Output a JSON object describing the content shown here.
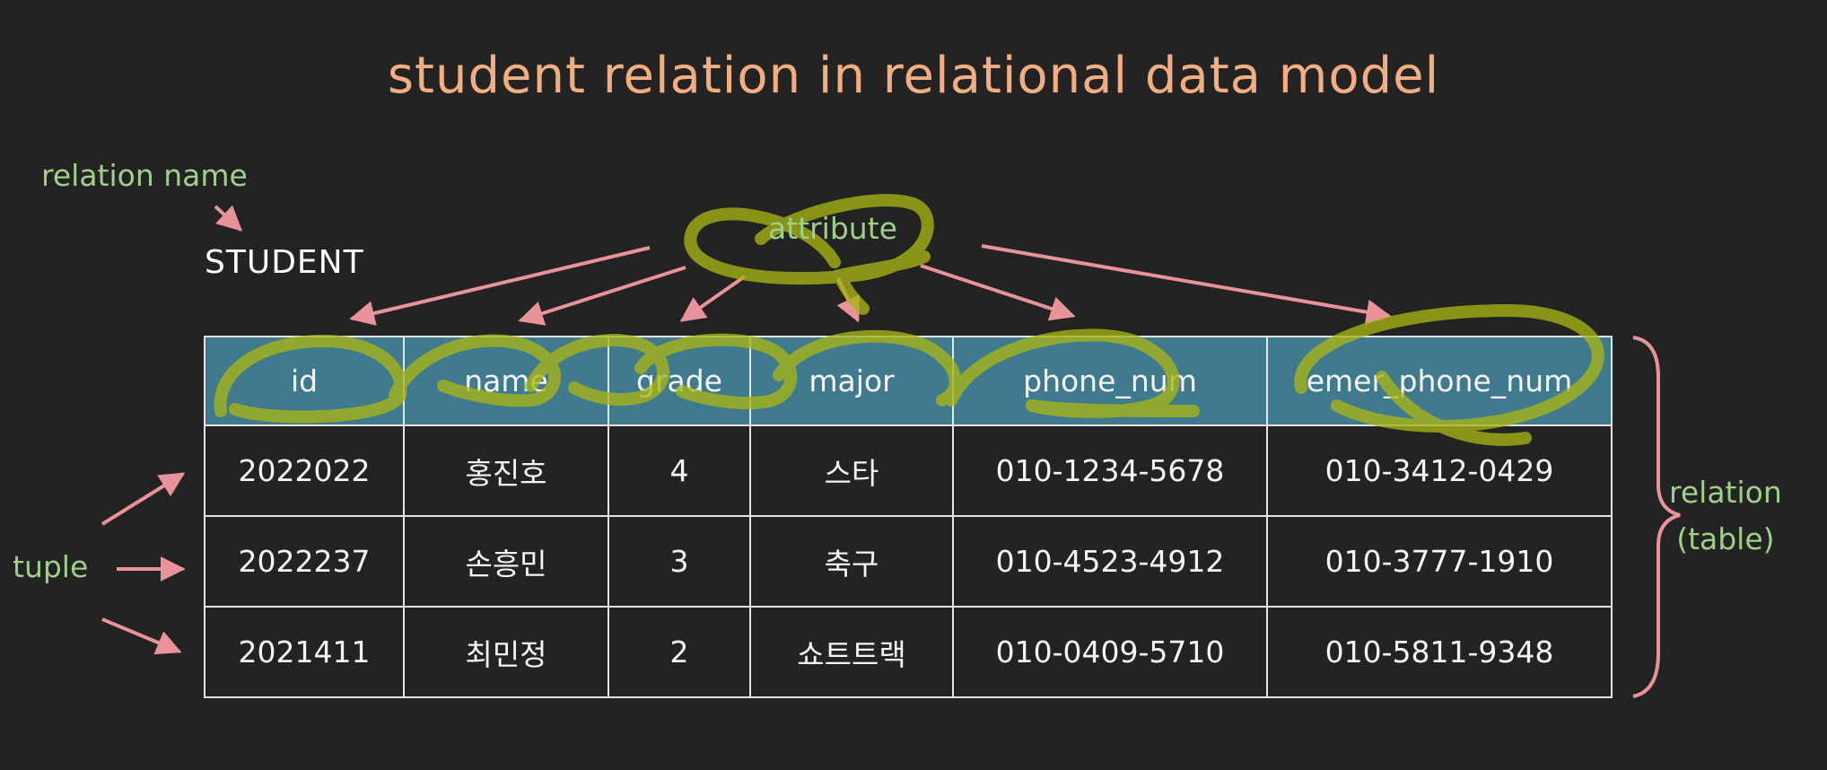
{
  "title": "student relation in relational data model",
  "labels": {
    "relation_name": "relation name",
    "attribute": "attribute",
    "tuple": "tuple",
    "relation_line1": "relation",
    "relation_line2": "(table)"
  },
  "relation_name_value": "STUDENT",
  "table": {
    "columns": [
      "id",
      "name",
      "grade",
      "major",
      "phone_num",
      "emer_phone_num"
    ],
    "rows": [
      [
        "2022022",
        "홍진호",
        "4",
        "스타",
        "010-1234-5678",
        "010-3412-0429"
      ],
      [
        "2022237",
        "손흥민",
        "3",
        "축구",
        "010-4523-4912",
        "010-3777-1910"
      ],
      [
        "2021411",
        "최민정",
        "2",
        "쇼트트랙",
        "010-0409-5710",
        "010-5811-9348"
      ]
    ]
  },
  "colors": {
    "background": "#232323",
    "title": "#f2ae80",
    "label": "#9fd08a",
    "arrow": "#e8929a",
    "header_fill": "#3f7a8f",
    "highlighter": "#a7b515"
  }
}
